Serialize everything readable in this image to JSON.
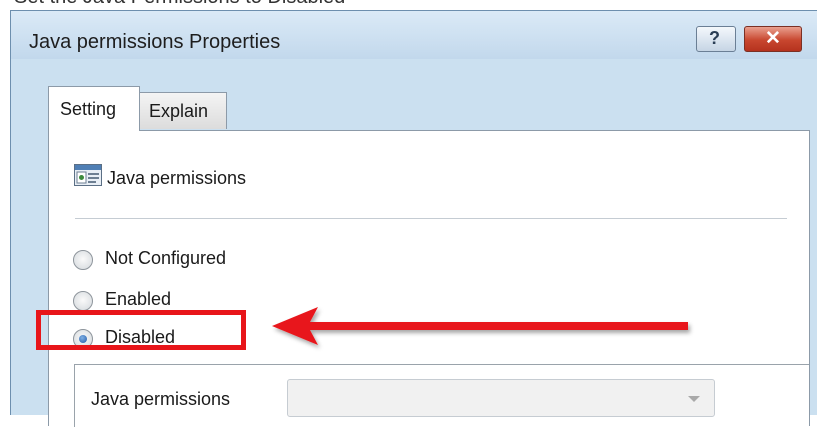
{
  "window": {
    "title": "Java permissions Properties",
    "help_button": "?",
    "close_button": "✕"
  },
  "tabs": [
    {
      "label": "Setting",
      "selected": true
    },
    {
      "label": "Explain",
      "selected": false
    }
  ],
  "policy": {
    "name": "Java permissions",
    "icon": "policy-setting-icon"
  },
  "radios": [
    {
      "label": "Not Configured",
      "checked": false
    },
    {
      "label": "Enabled",
      "checked": false
    },
    {
      "label": "Disabled",
      "checked": true
    }
  ],
  "options": {
    "label": "Java permissions",
    "dropdown_value": ""
  },
  "annotation": {
    "color": "#e8151a",
    "highlight_target": "Disabled",
    "arrow": "red-arrow-left"
  }
}
